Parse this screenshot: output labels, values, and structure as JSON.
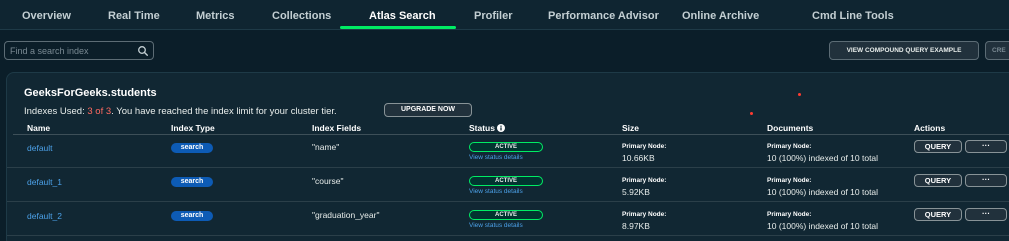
{
  "tabs": [
    {
      "label": "Overview",
      "active": false
    },
    {
      "label": "Real Time",
      "active": false
    },
    {
      "label": "Metrics",
      "active": false
    },
    {
      "label": "Collections",
      "active": false
    },
    {
      "label": "Atlas Search",
      "active": true
    },
    {
      "label": "Profiler",
      "active": false
    },
    {
      "label": "Performance Advisor",
      "active": false
    },
    {
      "label": "Online Archive",
      "active": false
    },
    {
      "label": "Cmd Line Tools",
      "active": false
    }
  ],
  "search": {
    "placeholder": "Find a search index"
  },
  "toolbar": {
    "compound_label": "VIEW COMPOUND QUERY EXAMPLE",
    "create_label": "CRE"
  },
  "card": {
    "title": "GeeksForGeeks.students",
    "usage_prefix": "Indexes Used: ",
    "usage_count": "3 of 3",
    "usage_suffix": ". You have reached the index limit for your cluster tier.",
    "upgrade_label": "UPGRADE NOW"
  },
  "table": {
    "headers": {
      "name": "Name",
      "index_type": "Index Type",
      "index_fields": "Index Fields",
      "status": "Status",
      "size": "Size",
      "documents": "Documents",
      "actions": "Actions"
    },
    "rows": [
      {
        "name": "default",
        "type": "search",
        "fields": "\"name\"",
        "status": "ACTIVE",
        "status_link": "View status details",
        "size_label": "Primary Node:",
        "size": "10.66KB",
        "docs_label": "Primary Node:",
        "docs": "10 (100%) indexed of 10 total",
        "query_label": "QUERY",
        "more_label": "···"
      },
      {
        "name": "default_1",
        "type": "search",
        "fields": "\"course\"",
        "status": "ACTIVE",
        "status_link": "View status details",
        "size_label": "Primary Node:",
        "size": "5.92KB",
        "docs_label": "Primary Node:",
        "docs": "10 (100%) indexed of 10 total",
        "query_label": "QUERY",
        "more_label": "···"
      },
      {
        "name": "default_2",
        "type": "search",
        "fields": "\"graduation_year\"",
        "status": "ACTIVE",
        "status_link": "View status details",
        "size_label": "Primary Node:",
        "size": "8.97KB",
        "docs_label": "Primary Node:",
        "docs": "10 (100%) indexed of 10 total",
        "query_label": "QUERY",
        "more_label": "···"
      }
    ]
  },
  "colors": {
    "background": "#0b1e29",
    "accent_green": "#00ed64",
    "link_blue": "#4ca1e8",
    "badge_blue": "#0d5bb5",
    "warning_red": "#ff6960"
  },
  "icons": {
    "search": "search-icon",
    "status_info": "info-icon"
  }
}
